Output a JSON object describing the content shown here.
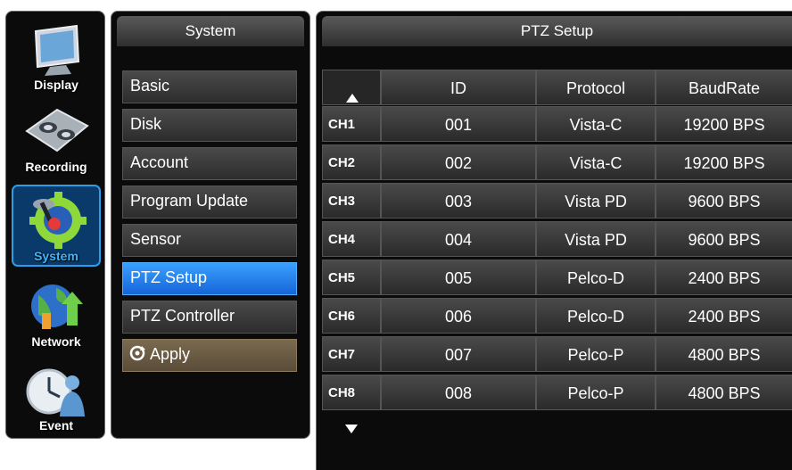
{
  "nav": [
    {
      "label": "Display",
      "icon": "monitor-icon",
      "active": false
    },
    {
      "label": "Recording",
      "icon": "film-reel-icon",
      "active": false
    },
    {
      "label": "System",
      "icon": "gear-joystick-icon",
      "active": true
    },
    {
      "label": "Network",
      "icon": "globe-network-icon",
      "active": false
    },
    {
      "label": "Event",
      "icon": "clock-person-icon",
      "active": false
    }
  ],
  "menu": {
    "title": "System",
    "items": [
      "Basic",
      "Disk",
      "Account",
      "Program Update",
      "Sensor",
      "PTZ Setup",
      "PTZ Controller"
    ],
    "selected": "PTZ Setup",
    "apply_label": "Apply"
  },
  "ptz": {
    "title": "PTZ Setup",
    "columns": [
      "ID",
      "Protocol",
      "BaudRate"
    ],
    "rows": [
      {
        "ch": "CH1",
        "id": "001",
        "protocol": "Vista-C",
        "baud": "19200 BPS"
      },
      {
        "ch": "CH2",
        "id": "002",
        "protocol": "Vista-C",
        "baud": "19200 BPS"
      },
      {
        "ch": "CH3",
        "id": "003",
        "protocol": "Vista PD",
        "baud": "9600 BPS"
      },
      {
        "ch": "CH4",
        "id": "004",
        "protocol": "Vista PD",
        "baud": "9600 BPS"
      },
      {
        "ch": "CH5",
        "id": "005",
        "protocol": "Pelco-D",
        "baud": "2400 BPS"
      },
      {
        "ch": "CH6",
        "id": "006",
        "protocol": "Pelco-D",
        "baud": "2400 BPS"
      },
      {
        "ch": "CH7",
        "id": "007",
        "protocol": "Pelco-P",
        "baud": "4800 BPS"
      },
      {
        "ch": "CH8",
        "id": "008",
        "protocol": "Pelco-P",
        "baud": "4800 BPS"
      }
    ]
  },
  "colors": {
    "accent": "#1f7fe8",
    "active_label": "#3cb6ff",
    "apply_bg": "#6a5c44"
  }
}
